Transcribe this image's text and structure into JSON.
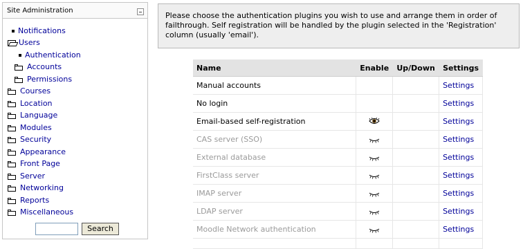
{
  "sidebar": {
    "title": "Site Administration",
    "items": [
      {
        "label": "Notifications",
        "icon": "bullet-icon"
      },
      {
        "label": "Users",
        "icon": "folder-open-icon"
      },
      {
        "label": "Authentication",
        "icon": "bullet-icon"
      },
      {
        "label": "Accounts",
        "icon": "folder-icon"
      },
      {
        "label": "Permissions",
        "icon": "folder-icon"
      },
      {
        "label": "Courses",
        "icon": "folder-icon"
      },
      {
        "label": "Location",
        "icon": "folder-icon"
      },
      {
        "label": "Language",
        "icon": "folder-icon"
      },
      {
        "label": "Modules",
        "icon": "folder-icon"
      },
      {
        "label": "Security",
        "icon": "folder-icon"
      },
      {
        "label": "Appearance",
        "icon": "folder-icon"
      },
      {
        "label": "Front Page",
        "icon": "folder-icon"
      },
      {
        "label": "Server",
        "icon": "folder-icon"
      },
      {
        "label": "Networking",
        "icon": "folder-icon"
      },
      {
        "label": "Reports",
        "icon": "folder-icon"
      },
      {
        "label": "Miscellaneous",
        "icon": "folder-icon"
      }
    ],
    "search": {
      "value": "",
      "button_label": "Search"
    }
  },
  "info": {
    "text": "Please choose the authentication plugins you wish to use and arrange them in order of failthrough. Self registration will be handled by the plugin selected in the 'Registration' column (usually 'email')."
  },
  "table": {
    "headers": {
      "name": "Name",
      "enable": "Enable",
      "updown": "Up/Down",
      "settings": "Settings"
    },
    "rows": [
      {
        "name": "Manual accounts",
        "enable": "none",
        "settings": "Settings",
        "enabled": true
      },
      {
        "name": "No login",
        "enable": "none",
        "settings": "Settings",
        "enabled": true
      },
      {
        "name": "Email-based self-registration",
        "enable": "eye-open-icon",
        "settings": "Settings",
        "enabled": true
      },
      {
        "name": "CAS server (SSO)",
        "enable": "eye-closed-icon",
        "settings": "Settings",
        "enabled": false
      },
      {
        "name": "External database",
        "enable": "eye-closed-icon",
        "settings": "Settings",
        "enabled": false
      },
      {
        "name": "FirstClass server",
        "enable": "eye-closed-icon",
        "settings": "Settings",
        "enabled": false
      },
      {
        "name": "IMAP server",
        "enable": "eye-closed-icon",
        "settings": "Settings",
        "enabled": false
      },
      {
        "name": "LDAP server",
        "enable": "eye-closed-icon",
        "settings": "Settings",
        "enabled": false
      },
      {
        "name": "Moodle Network authentication",
        "enable": "eye-closed-icon",
        "settings": "Settings",
        "enabled": false
      }
    ]
  },
  "colors": {
    "link": "#000099",
    "disabled_text": "#9a9a9a",
    "header_bg": "#e3e3e3",
    "info_bg": "#eeeeee"
  }
}
